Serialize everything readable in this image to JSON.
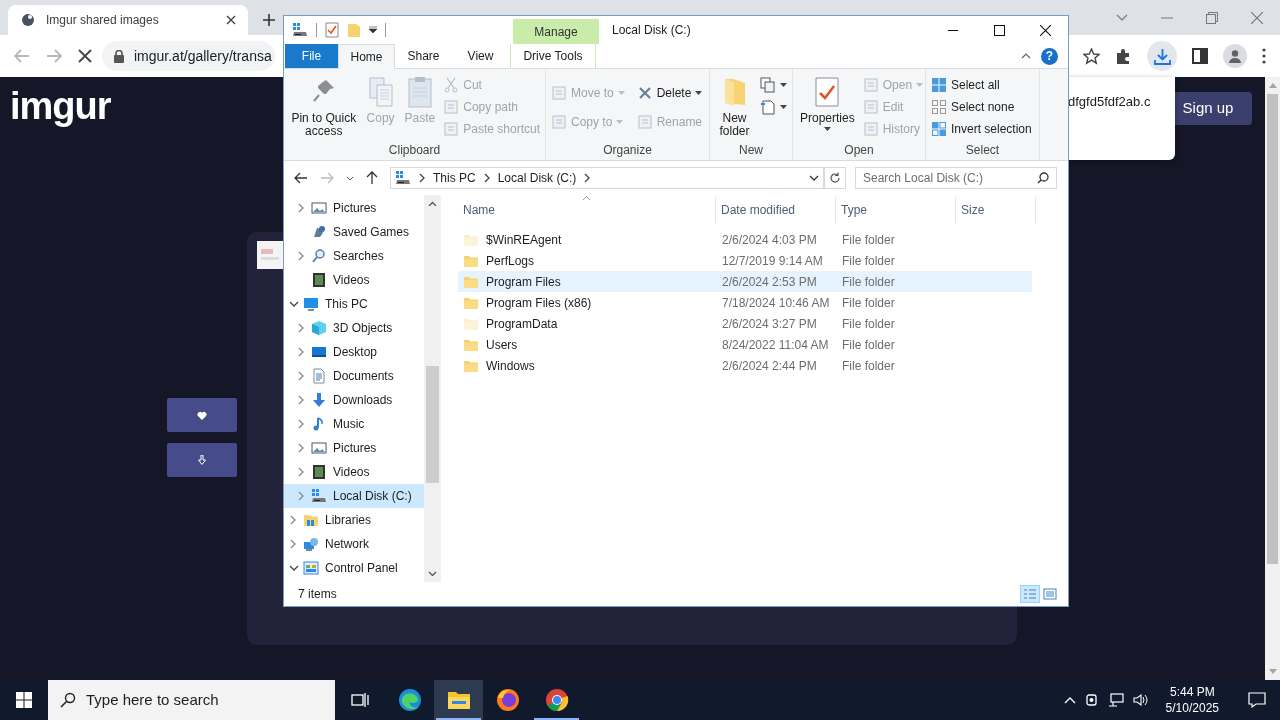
{
  "browser": {
    "tab": {
      "title": "Imgur shared images"
    },
    "address": "imgur.at/gallery/transa",
    "loading": true
  },
  "page": {
    "logo": "imgur",
    "sign_up": "Sign up",
    "download_bubble": {
      "text": "dfgfd5fdf2ab.c"
    }
  },
  "explorer": {
    "title": "Local Disk (C:)",
    "context_group": "Manage",
    "help": "?",
    "tabs": [
      {
        "label": "File",
        "kind": "file",
        "selected": false
      },
      {
        "label": "Home",
        "kind": "normal",
        "selected": true
      },
      {
        "label": "Share",
        "kind": "normal",
        "selected": false
      },
      {
        "label": "View",
        "kind": "normal",
        "selected": false
      },
      {
        "label": "Drive Tools",
        "kind": "context",
        "selected": false
      }
    ],
    "ribbon": {
      "groups": [
        {
          "label": "Clipboard",
          "items": [
            {
              "label": "Pin to Quick access",
              "kind": "large",
              "disabled": false,
              "dropdown": false
            },
            {
              "label": "Copy",
              "kind": "large",
              "disabled": true,
              "dropdown": false
            },
            {
              "label": "Paste",
              "kind": "large",
              "disabled": true,
              "dropdown": false
            },
            {
              "label": "Cut",
              "kind": "small",
              "disabled": true,
              "dropdown": false
            },
            {
              "label": "Copy path",
              "kind": "small",
              "disabled": true,
              "dropdown": false
            },
            {
              "label": "Paste shortcut",
              "kind": "small",
              "disabled": true,
              "dropdown": false
            }
          ]
        },
        {
          "label": "Organize",
          "items": [
            {
              "label": "Move to",
              "kind": "small",
              "disabled": true,
              "dropdown": true
            },
            {
              "label": "Copy to",
              "kind": "small",
              "disabled": true,
              "dropdown": true
            },
            {
              "label": "Delete",
              "kind": "small",
              "disabled": false,
              "dropdown": true
            },
            {
              "label": "Rename",
              "kind": "small",
              "disabled": true,
              "dropdown": false
            }
          ]
        },
        {
          "label": "New",
          "items": [
            {
              "label": "New folder",
              "kind": "large",
              "disabled": false,
              "dropdown": false
            },
            {
              "kind": "icon",
              "disabled": false,
              "dropdown": true
            },
            {
              "kind": "icon",
              "disabled": false,
              "dropdown": true
            }
          ]
        },
        {
          "label": "Open",
          "items": [
            {
              "label": "Properties",
              "kind": "large",
              "disabled": false,
              "dropdown": true
            },
            {
              "label": "Open",
              "kind": "small",
              "disabled": true,
              "dropdown": true
            },
            {
              "label": "Edit",
              "kind": "small",
              "disabled": true,
              "dropdown": false
            },
            {
              "label": "History",
              "kind": "small",
              "disabled": true,
              "dropdown": false
            }
          ]
        },
        {
          "label": "Select",
          "items": [
            {
              "label": "Select all",
              "kind": "small",
              "disabled": false,
              "dropdown": false
            },
            {
              "label": "Select none",
              "kind": "small",
              "disabled": false,
              "dropdown": false
            },
            {
              "label": "Invert selection",
              "kind": "small",
              "disabled": false,
              "dropdown": false
            }
          ]
        }
      ]
    },
    "breadcrumbs": [
      "This PC",
      "Local Disk (C:)"
    ],
    "search": {
      "placeholder": "Search Local Disk (C:)"
    },
    "nav_tree": [
      {
        "children": [
          {
            "label": "Pictures",
            "kind": "pictures",
            "expandable": true,
            "expanded": false,
            "selected": false
          },
          {
            "label": "Saved Games",
            "kind": "games",
            "expandable": false,
            "selected": false
          },
          {
            "label": "Searches",
            "kind": "search",
            "expandable": true,
            "expanded": false,
            "selected": false
          },
          {
            "label": "Videos",
            "kind": "videos",
            "expandable": false,
            "selected": false
          }
        ]
      },
      {
        "label": "This PC",
        "kind": "pc",
        "expandable": true,
        "expanded": true,
        "selected": false,
        "children": [
          {
            "label": "3D Objects",
            "kind": "objects",
            "expandable": true,
            "expanded": false,
            "selected": false
          },
          {
            "label": "Desktop",
            "kind": "desktop",
            "expandable": true,
            "expanded": false,
            "selected": false
          },
          {
            "label": "Documents",
            "kind": "documents",
            "expandable": true,
            "expanded": false,
            "selected": false
          },
          {
            "label": "Downloads",
            "kind": "downloads",
            "expandable": true,
            "expanded": false,
            "selected": false
          },
          {
            "label": "Music",
            "kind": "music",
            "expandable": true,
            "expanded": false,
            "selected": false
          },
          {
            "label": "Pictures",
            "kind": "pictures",
            "expandable": true,
            "expanded": false,
            "selected": false
          },
          {
            "label": "Videos",
            "kind": "videos",
            "expandable": true,
            "expanded": false,
            "selected": false
          },
          {
            "label": "Local Disk (C:)",
            "kind": "drive",
            "expandable": true,
            "expanded": false,
            "selected": true
          }
        ]
      },
      {
        "label": "Libraries",
        "kind": "libraries",
        "expandable": true,
        "expanded": false,
        "selected": false
      },
      {
        "label": "Network",
        "kind": "network",
        "expandable": true,
        "expanded": false,
        "selected": false
      },
      {
        "label": "Control Panel",
        "kind": "control",
        "expandable": true,
        "expanded": true,
        "selected": false
      }
    ],
    "columns": [
      "Name",
      "Date modified",
      "Type",
      "Size"
    ],
    "rows": [
      {
        "name": "$WinREAgent",
        "date": "2/6/2024 4:03 PM",
        "type": "File folder",
        "hidden": true,
        "selected": false
      },
      {
        "name": "PerfLogs",
        "date": "12/7/2019 9:14 AM",
        "type": "File folder",
        "hidden": false,
        "selected": false
      },
      {
        "name": "Program Files",
        "date": "2/6/2024 2:53 PM",
        "type": "File folder",
        "hidden": false,
        "selected": true
      },
      {
        "name": "Program Files (x86)",
        "date": "7/18/2024 10:46 AM",
        "type": "File folder",
        "hidden": false,
        "selected": false
      },
      {
        "name": "ProgramData",
        "date": "2/6/2024 3:27 PM",
        "type": "File folder",
        "hidden": true,
        "selected": false
      },
      {
        "name": "Users",
        "date": "8/24/2022 11:04 AM",
        "type": "File folder",
        "hidden": false,
        "selected": false
      },
      {
        "name": "Windows",
        "date": "2/6/2024 2:44 PM",
        "type": "File folder",
        "hidden": false,
        "selected": false
      }
    ],
    "status": "7 items",
    "views": [
      {
        "kind": "details",
        "selected": true
      },
      {
        "kind": "tiles",
        "selected": false
      }
    ]
  },
  "taskbar": {
    "search": {
      "placeholder": "Type here to search"
    },
    "apps": [
      {
        "kind": "edge",
        "running": false,
        "active": false
      },
      {
        "kind": "explorer",
        "running": true,
        "active": true
      },
      {
        "kind": "firefox",
        "running": false,
        "active": false
      },
      {
        "kind": "chrome",
        "running": true,
        "active": false
      }
    ],
    "time": "5:44 PM",
    "date": "5/10/2025"
  }
}
